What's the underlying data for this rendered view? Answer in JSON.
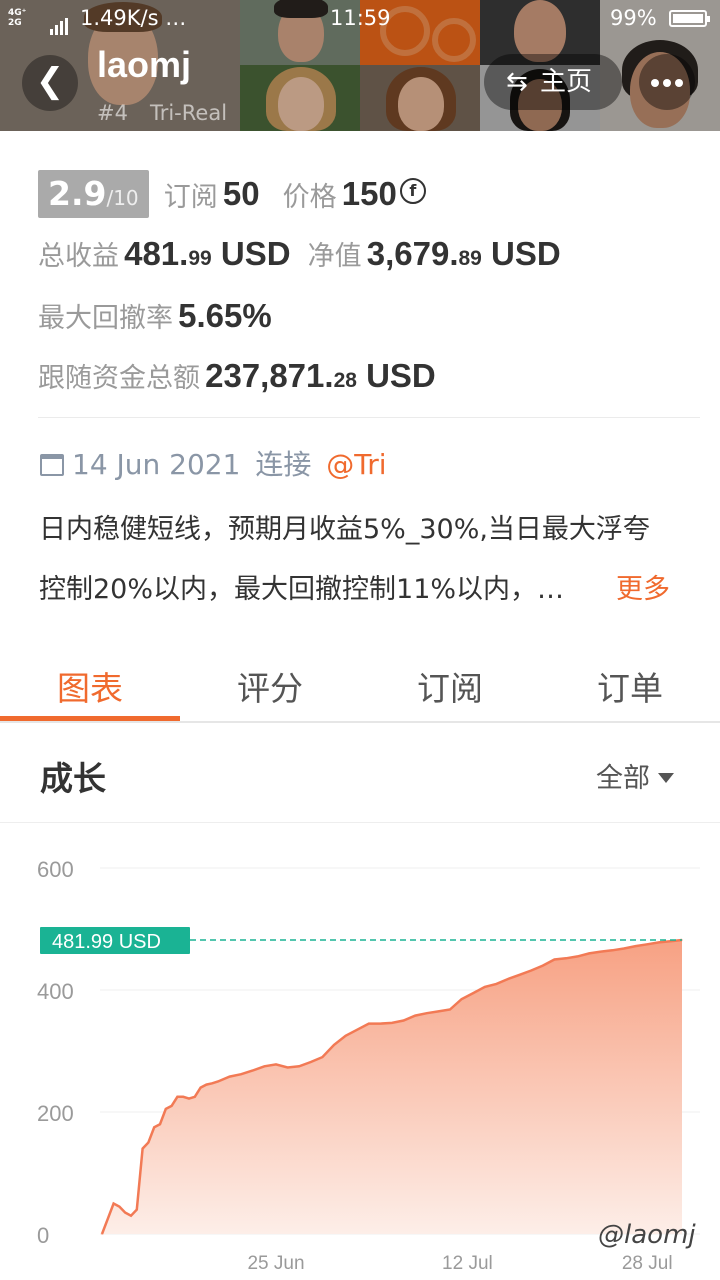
{
  "status_bar": {
    "network": [
      "4G⁺",
      "2G"
    ],
    "speed": "1.49K/s …",
    "time": "11:59",
    "battery": "99%"
  },
  "header": {
    "name": "laomj",
    "rank": "#4",
    "account": "Tri-Real",
    "home_label": "主页",
    "icons": [
      "back-arrow-icon",
      "swap-icon",
      "more-dots-icon"
    ]
  },
  "stats": {
    "score": "2.9",
    "score_max": "/10",
    "subscribe_label": "订阅",
    "subscribe_value": "50",
    "price_label": "价格",
    "price_value": "150",
    "currency_icon": "coin-icon",
    "total_profit_label": "总收益",
    "total_profit_int": "481.",
    "total_profit_dec": "99",
    "total_profit_unit": "USD",
    "equity_label": "净值",
    "equity_int": "3,679.",
    "equity_dec": "89",
    "equity_unit": "USD",
    "max_drawdown_label": "最大回撤率",
    "max_drawdown_value": "5.65%",
    "follow_funds_label": "跟随资金总额",
    "follow_funds_int": "237,871.",
    "follow_funds_dec": "28",
    "follow_funds_unit": "USD"
  },
  "meta": {
    "date": "14 Jun 2021",
    "connect_label": "连接",
    "broker": "@Tri"
  },
  "description": {
    "line1": "日内稳健短线，预期月收益5%_30%,当日最大浮夸",
    "line2": "控制20%以内，最大回撤控制11%以内，…",
    "more": "更多"
  },
  "tabs": [
    "图表",
    "评分",
    "订阅",
    "订单"
  ],
  "active_tab": 0,
  "section": {
    "title": "成长",
    "filter": "全部"
  },
  "chart_data": {
    "type": "area",
    "ylim": [
      0,
      600
    ],
    "yticks": [
      "0",
      "200",
      "400",
      "600"
    ],
    "xticks": [
      "25 Jun",
      "12 Jul",
      "28 Jul"
    ],
    "current_label": "481.99 USD",
    "current_value": 481.99,
    "x_index_range": [
      0,
      100
    ],
    "xtick_positions": [
      30,
      63,
      94
    ],
    "x": [
      0,
      1,
      2,
      3,
      4,
      5,
      6,
      7,
      8,
      9,
      10,
      11,
      12,
      13,
      14,
      15,
      16,
      17,
      18,
      19,
      20,
      22,
      24,
      26,
      28,
      30,
      32,
      34,
      36,
      38,
      40,
      42,
      44,
      46,
      48,
      50,
      52,
      54,
      56,
      58,
      60,
      62,
      64,
      66,
      68,
      70,
      72,
      74,
      76,
      78,
      80,
      82,
      84,
      86,
      88,
      90,
      92,
      94,
      96,
      98,
      100
    ],
    "y": [
      0,
      25,
      50,
      45,
      35,
      30,
      40,
      140,
      150,
      175,
      180,
      205,
      210,
      225,
      225,
      222,
      225,
      240,
      245,
      247,
      250,
      258,
      262,
      268,
      275,
      278,
      273,
      275,
      282,
      290,
      310,
      325,
      335,
      345,
      345,
      346,
      350,
      358,
      362,
      365,
      368,
      385,
      395,
      405,
      410,
      418,
      425,
      432,
      440,
      450,
      452,
      455,
      460,
      463,
      465,
      468,
      472,
      475,
      478,
      480,
      481.99
    ],
    "colors": {
      "area_top": "#f7a183",
      "area_bottom": "#fdeee8",
      "line": "#f27a55",
      "current": "#1ab394",
      "grid": "#efefef"
    }
  },
  "watermark": "@laomj",
  "colors": {
    "accent": "#f06a2e",
    "badge": "#aaaaaa"
  }
}
